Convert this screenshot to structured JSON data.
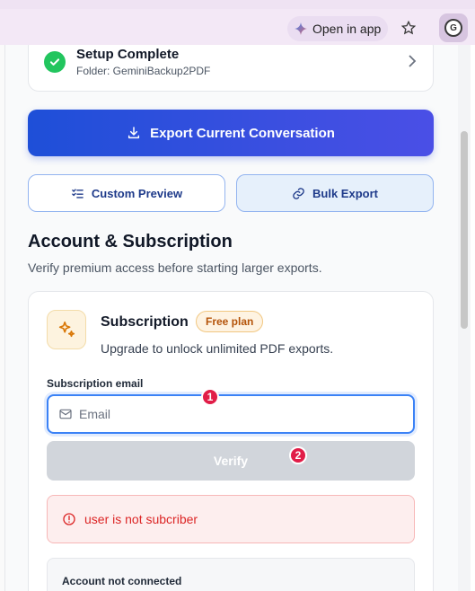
{
  "browser": {
    "open_in_app_label": "Open in app"
  },
  "setup": {
    "title": "Setup Complete",
    "folder": "Folder: GeminiBackup2PDF"
  },
  "actions": {
    "export_label": "Export Current Conversation",
    "preview_label": "Custom Preview",
    "bulk_label": "Bulk Export"
  },
  "account": {
    "heading": "Account & Subscription",
    "subheading": "Verify premium access before starting larger exports."
  },
  "subscription": {
    "title": "Subscription",
    "plan_badge": "Free plan",
    "description": "Upgrade to unlock unlimited PDF exports.",
    "email_label": "Subscription email",
    "email_placeholder": "Email",
    "email_value": "",
    "verify_label": "Verify",
    "error_message": "user is not subcriber",
    "account_status": "Account not connected"
  },
  "markers": [
    "1",
    "2"
  ],
  "colors": {
    "primary": "#2446dc",
    "success": "#22c55e",
    "error": "#dc2626",
    "badge": "#b45309",
    "marker": "#e11d48"
  },
  "icons": {
    "setup": "check-circle-icon",
    "export": "download-icon",
    "preview": "list-check-icon",
    "bulk": "link-icon",
    "subscription": "sparkles-icon",
    "email": "mail-icon",
    "error": "alert-circle-icon"
  }
}
